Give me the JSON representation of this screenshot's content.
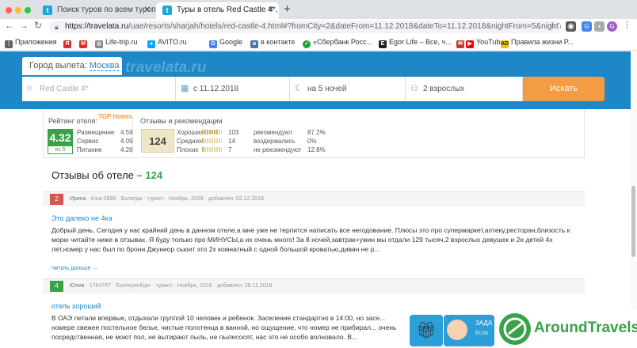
{
  "browser": {
    "tabs": [
      {
        "title": "Поиск туров по всем туропер"
      },
      {
        "title": "Туры в отель Red Castle 4*, С"
      }
    ],
    "new_tab": "+",
    "url_host": "https://travelata.ru",
    "url_path": "/uae/resorts/sharjah/hotels/red-castle-4.html#?fromCity=2&dateFrom=11.12.2018&dateTo=11.12.2018&nightFrom=5&nightTo...",
    "profile_initial": "G"
  },
  "bookmarks": [
    {
      "label": "Приложения",
      "icon": "apps-grid-icon",
      "color": "#5f6368"
    },
    {
      "label": "",
      "icon": "yandex-icon",
      "color": "#e02a2a"
    },
    {
      "label": "",
      "icon": "gmail-icon",
      "color": "#d93025"
    },
    {
      "label": "Life-trip.ru",
      "icon": "globe-icon",
      "color": "#888888"
    },
    {
      "label": "AVITO.ru",
      "icon": "avito-icon",
      "color": "#00aaff"
    },
    {
      "label": "Google",
      "icon": "google-icon",
      "color": "#4285f4"
    },
    {
      "label": "в контакте",
      "icon": "vk-icon",
      "color": "#4a76a8"
    },
    {
      "label": "«Сбербанк Росс...",
      "icon": "sberbank-icon",
      "color": "#21a038"
    },
    {
      "label": "Egor Life – Все, ч...",
      "icon": "egor-life-icon",
      "color": "#222222"
    },
    {
      "label": "",
      "icon": "mail-icon",
      "color": "#c0392b"
    },
    {
      "label": "YouTube",
      "icon": "youtube-icon",
      "color": "#ff0000"
    },
    {
      "label": "Правила жизни Р...",
      "icon": "ad-icon",
      "color": "#f1c40f"
    }
  ],
  "search": {
    "logo": "travelata.ru",
    "city_label": "Город вылета:",
    "city_value": "Москва",
    "hotel_placeholder": "Red Castle 4*",
    "date": "с 11.12.2018",
    "nights": "на 5 ночей",
    "guests": "2 взрослых",
    "button": "Искать"
  },
  "rating": {
    "title": "Рейтинг отеля:",
    "logo": "TOP Hotels",
    "score": "4.32",
    "out_of": "из 5",
    "criteria": [
      {
        "label": "Размещение",
        "value": "4.59"
      },
      {
        "label": "Сервис",
        "value": "4.09"
      },
      {
        "label": "Питание",
        "value": "4.26"
      }
    ]
  },
  "feedback": {
    "title": "Отзывы и рекомендации",
    "total": "124",
    "breakdown": [
      {
        "label": "Хороших",
        "count": "103",
        "fill": 0.83
      },
      {
        "label": "Средних",
        "count": "14",
        "fill": 0.11
      },
      {
        "label": "Плохих",
        "count": "7",
        "fill": 0.06
      }
    ],
    "recommend": [
      {
        "label": "рекомендуют",
        "value": "87.2%"
      },
      {
        "label": "воздержались",
        "value": "0%"
      },
      {
        "label": "не рекомендуют",
        "value": "12.8%"
      }
    ]
  },
  "reviews_section": {
    "title": "Отзывы об отеле",
    "dash": " – ",
    "count": "124"
  },
  "reviews": [
    {
      "score": "2",
      "color": "#d9534f",
      "author": "Ирина",
      "meta": " · Irina-2899 · Вологда · турист · Ноябрь, 2018 · добавлен: 02.12.2018",
      "title": "Это далеко не 4ка",
      "text": "Добрый день. Сегодня у нас крайний день в данном отеле,а мне уже не терпится написать все негодование. Плюсы это про супермаркет,аптеку,ресторан,близость к морю читайте ниже в отзывах. Я буду только про МИНУСЫ,а их очень много! За 8 ночей,завтрак+ужин мы отдали 129 тысяч,2 взрослых девушек и 2е детей 4х лет,номер у нас был по брони Джуниор сьюит это 2х комнатный с одной большой кроватью,диван не р...",
      "more": "Читать дальше →"
    },
    {
      "score": "4",
      "color": "#3aa24a",
      "author": "Юлия",
      "meta": " · 1764747 · Екатеринбург · турист · Ноябрь, 2018 · добавлен: 28.11.2018",
      "title": "отель хороший",
      "text": "В ОАЭ летали впервые, отдыхали группой 10 человек и ребенок. Заселение стандартно в 14:00, но засе... номере свежее постельное белье, чистые полотенца в ванной, но ощущение, что номер не прибирал... очень посредственная, не моют пол, не вытирают пыль, не пылесосят, нас это не особо волновало. В..."
    }
  ],
  "widgets": {
    "chat_label": "ЗАДА",
    "chat_sub": "Если",
    "brand": "AroundTravels"
  }
}
